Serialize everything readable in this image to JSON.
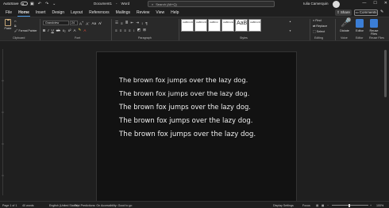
{
  "titlebar": {
    "autosave_label": "AutoSave",
    "autosave_state": "Off",
    "document_name": "Document1",
    "app_name": "Word",
    "search_placeholder": "Search (Alt+Q)",
    "user_name": "Iulia Camerquin",
    "min_glyph": "—",
    "max_glyph": "☐",
    "close_glyph": "✕"
  },
  "menu": {
    "tabs": [
      "File",
      "Home",
      "Insert",
      "Design",
      "Layout",
      "References",
      "Mailings",
      "Review",
      "View",
      "Help"
    ],
    "active_tab": "Home",
    "share_label": "Share",
    "comments_label": "Comments"
  },
  "ribbon": {
    "paste_label": "Paste",
    "format_painter_label": "Format Painter",
    "font_name": "Grandview",
    "font_size": "24",
    "style_tiles": [
      "AaBbCcDc",
      "AaBbCcDc",
      "AaBbCc",
      "AaBbCcE",
      "AaB",
      "AaBbCcD"
    ],
    "find_label": "Find",
    "replace_label": "Replace",
    "select_label": "Select",
    "dictate_label": "Dictate",
    "editor_label": "Editor",
    "reuse_files_label": "Reuse Files",
    "group_labels": {
      "clipboard": "Clipboard",
      "font": "Font",
      "paragraph": "Paragraph",
      "styles": "Styles",
      "editing": "Editing",
      "voice": "Voice",
      "editor": "Editor",
      "reuse_files": "Reuse Files"
    }
  },
  "document": {
    "lines": [
      "The brown fox jumps over the lazy dog.",
      "The brown fox jumps over the lazy dog.",
      "The brown fox jumps over the lazy dog.",
      "The brown fox jumps over the lazy dog.",
      "The brown fox jumps over the lazy dog."
    ]
  },
  "statusbar": {
    "page": "Page 1 of 1",
    "words": "40 words",
    "language": "English (United States)",
    "text_predictions": "Text Predictions: On",
    "accessibility": "Accessibility: Good to go",
    "display_settings": "Display Settings",
    "focus": "Focus",
    "zoom": "100%"
  },
  "colors": {
    "accent": "#4d9be6",
    "background": "#1f1f1f",
    "page": "#121212"
  }
}
